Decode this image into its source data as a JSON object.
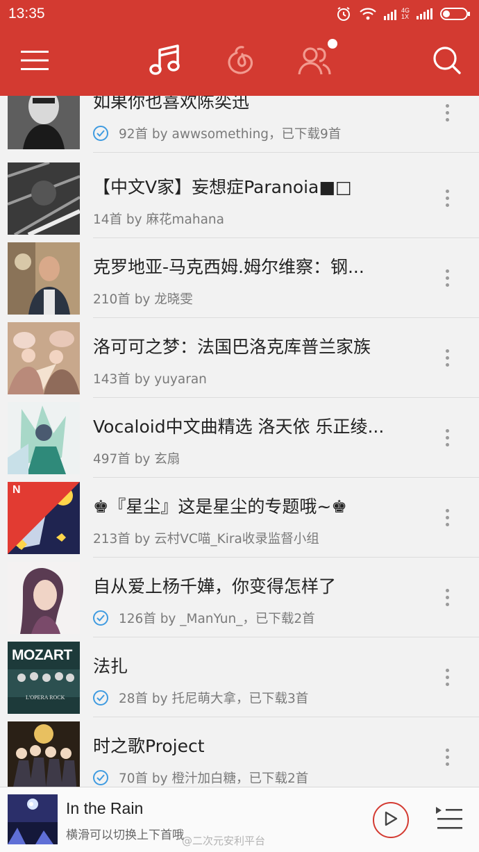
{
  "status_bar": {
    "time": "13:35",
    "network_label": "4G",
    "network_sub": "1X",
    "icons": [
      "alarm-icon",
      "wifi-icon",
      "signal-icon",
      "signal-icon",
      "battery-icon"
    ]
  },
  "topbar": {
    "icons": [
      "menu-icon",
      "music-icon",
      "netease-logo-icon",
      "friends-icon",
      "search-icon"
    ],
    "active_tab": "music",
    "friends_notification": true
  },
  "playlists": [
    {
      "title": "如果你也喜欢陈奕迅",
      "subtitle": "92首 by awwsomething，已下载9首",
      "downloaded": true
    },
    {
      "title": "【中文V家】妄想症Paranoia■□",
      "subtitle": "14首 by 麻花mahana",
      "downloaded": false
    },
    {
      "title": "克罗地亚-马克西姆.姆尔维察：钢...",
      "subtitle": "210首 by 龙晓雯",
      "downloaded": false
    },
    {
      "title": "洛可可之梦：法国巴洛克库普兰家族",
      "subtitle": "143首 by yuyaran",
      "downloaded": false
    },
    {
      "title": "Vocaloid中文曲精选 洛天依 乐正绫...",
      "subtitle": "497首 by 玄扇",
      "downloaded": false
    },
    {
      "title": "♚『星尘』这是星尘的专题哦~♚",
      "subtitle": "213首 by 云村VC喵_Kira收录监督小组",
      "downloaded": false,
      "badge": "N"
    },
    {
      "title": "自从爱上杨千嬅，你变得怎样了",
      "subtitle": "126首 by _ManYun_，已下载2首",
      "downloaded": true
    },
    {
      "title": "法扎",
      "subtitle": "28首 by 托尼萌大拿，已下载3首",
      "downloaded": true,
      "cover_text": "MOZART",
      "cover_subtext": "L'OPERA ROCK"
    },
    {
      "title": "时之歌Project",
      "subtitle": "70首 by 橙汁加白糖，已下载2首",
      "downloaded": true
    }
  ],
  "player": {
    "title": "In the Rain",
    "subtitle": "横滑可以切换上下首哦",
    "watermark": "@二次元安利平台",
    "icons": [
      "play-icon",
      "queue-icon"
    ]
  },
  "colors": {
    "brand_red": "#d33a31",
    "check_blue": "#3f9be0",
    "list_bg": "#f2f2f2"
  }
}
